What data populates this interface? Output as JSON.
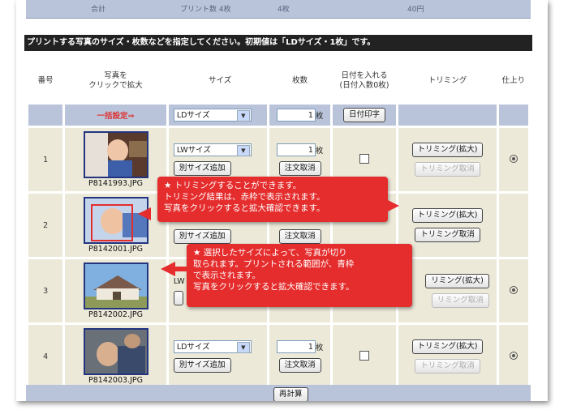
{
  "top_bar": {
    "col1": "合計",
    "col2": "プリント数 4枚",
    "col3": "4枚",
    "col4": "40円"
  },
  "instruction": "プリントする写真のサイズ・枚数などを指定してください。初期値は「LDサイズ・1枚」です。",
  "headers": {
    "number": "番号",
    "photo": "写真を\nクリックで拡大",
    "size": "サイズ",
    "quantity": "枚数",
    "date": "日付を入れる\n(日付入数0枚)",
    "trimming": "トリミング",
    "finish": "仕上り"
  },
  "bulk": {
    "label": "一括設定⇒",
    "size": "LDサイズ",
    "quantity": "1",
    "unit": "枚",
    "date_button": "日付印字"
  },
  "rows": [
    {
      "number": "1",
      "filename": "P8141993.JPG",
      "size": "LWサイズ",
      "quantity": "1",
      "unit": "枚",
      "add_size": "別サイズ追加",
      "cancel": "注文取消",
      "trim": "トリミング(拡大)",
      "trim_cancel": "トリミング取消"
    },
    {
      "number": "2",
      "filename": "P8142001.JPG",
      "size": "",
      "quantity": "",
      "unit": "",
      "add_size": "別サイズ追加",
      "cancel": "注文取消",
      "trim": "トリミング(拡大)",
      "trim_cancel": "トリミング取消"
    },
    {
      "number": "3",
      "filename": "P8142002.JPG",
      "size": "LW",
      "quantity": "",
      "unit": "",
      "add_size": "",
      "cancel": "",
      "trim": "リミング(拡大)",
      "trim_cancel": "リミング取消"
    },
    {
      "number": "4",
      "filename": "P8142003.JPG",
      "size": "LDサイズ",
      "quantity": "1",
      "unit": "枚",
      "add_size": "別サイズ追加",
      "cancel": "注文取消",
      "trim": "トリミング(拡大)",
      "trim_cancel": "トリミング取消"
    }
  ],
  "recalc": "再計算",
  "callout1": {
    "line1": "★ トリミングすることができます。",
    "line2": "トリミング結果は、赤枠で表示されます。",
    "line3": "写真をクリックすると拡大確認できます。"
  },
  "callout2": {
    "line1": "★ 選択したサイズによって、写真が切り",
    "line2": "取られます。プリントされる範囲が、青枠",
    "line3": "で表示されます。",
    "line4": "写真をクリックすると拡大確認できます。"
  },
  "colors": {
    "accent_red": "#e52d2d",
    "header_bar": "#222222",
    "table_blue": "#b9c4da",
    "row_beige": "#ece9d9",
    "thumb_border": "#23357f"
  }
}
